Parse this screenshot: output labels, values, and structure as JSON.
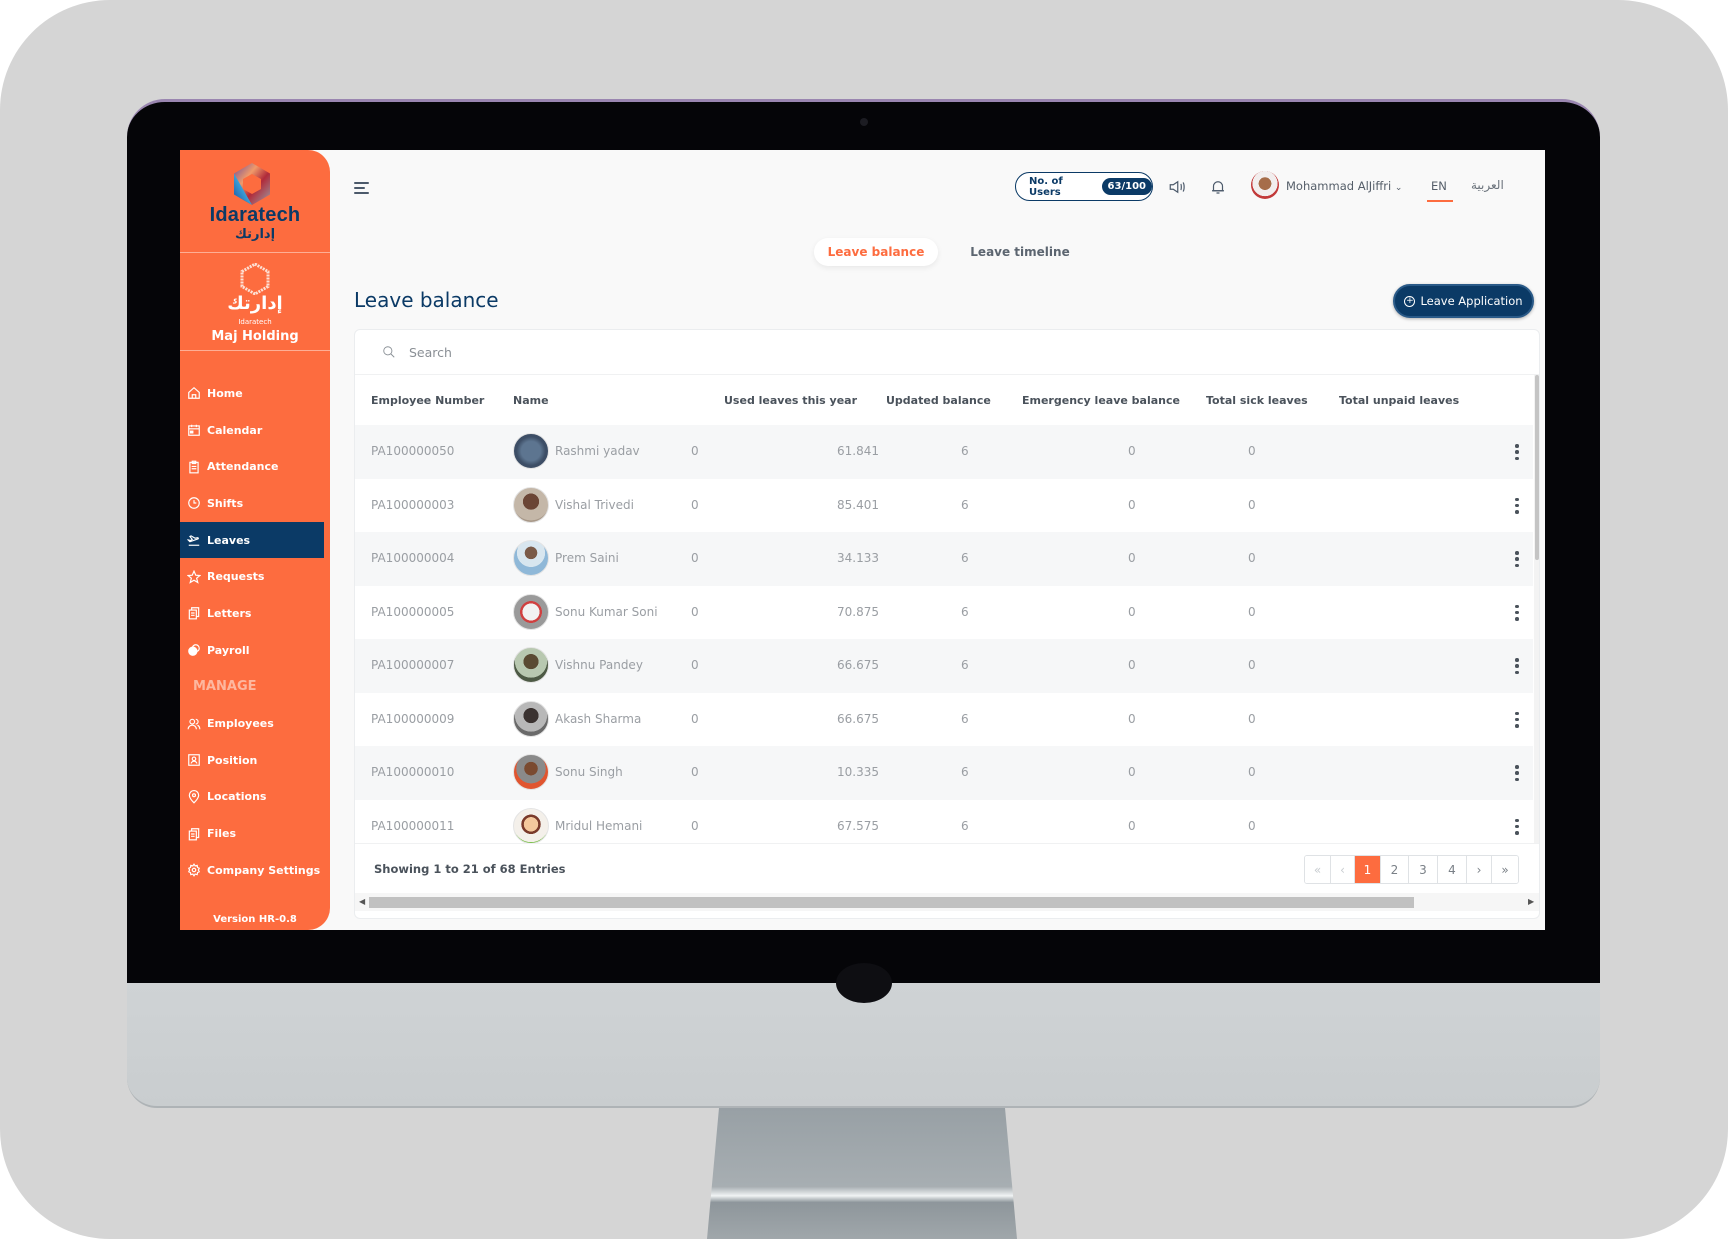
{
  "brand": {
    "logo_text": "Idaratech",
    "logo_arabic": "إدارتك",
    "company_arabic": "إدارتك",
    "company_sub": "Idaratech",
    "company_name": "Maj Holding",
    "accent_color": "#fd6c3f",
    "primary_color": "#0b3a66"
  },
  "sidebar": {
    "items": [
      {
        "label": "Home",
        "icon": "home-icon"
      },
      {
        "label": "Calendar",
        "icon": "calendar-icon"
      },
      {
        "label": "Attendance",
        "icon": "clipboard-icon"
      },
      {
        "label": "Shifts",
        "icon": "clock-icon"
      },
      {
        "label": "Leaves",
        "icon": "airplane-departure-icon",
        "active": true
      },
      {
        "label": "Requests",
        "icon": "star-icon"
      },
      {
        "label": "Letters",
        "icon": "documents-icon"
      },
      {
        "label": "Payroll",
        "icon": "coins-icon"
      }
    ],
    "section_label": "MANAGE",
    "manage_items": [
      {
        "label": "Employees",
        "icon": "users-icon"
      },
      {
        "label": "Position",
        "icon": "id-card-icon"
      },
      {
        "label": "Locations",
        "icon": "map-pin-icon"
      },
      {
        "label": "Files",
        "icon": "files-icon"
      },
      {
        "label": "Company Settings",
        "icon": "gear-icon"
      }
    ],
    "version": "Version HR-0.8"
  },
  "topbar": {
    "users_label": "No. of Users",
    "users_count": "63/100",
    "user_name": "Mohammad AlJiffri",
    "lang_en": "EN",
    "lang_ar": "العربية"
  },
  "tabs": [
    {
      "label": "Leave balance",
      "active": true
    },
    {
      "label": "Leave timeline",
      "active": false
    }
  ],
  "page": {
    "title": "Leave balance",
    "leave_application_label": "Leave Application",
    "search_placeholder": "Search"
  },
  "table": {
    "columns": [
      "Employee Number",
      "Name",
      "Used leaves this year",
      "Updated balance",
      "Emergency leave balance",
      "Total sick leaves",
      "Total unpaid leaves"
    ],
    "rows": [
      {
        "employee_number": "PA100000050",
        "name": "Rashmi yadav",
        "used": "0",
        "balance": "61.841",
        "emergency": "6",
        "sick": "0",
        "unpaid": "0"
      },
      {
        "employee_number": "PA100000003",
        "name": "Vishal Trivedi",
        "used": "0",
        "balance": "85.401",
        "emergency": "6",
        "sick": "0",
        "unpaid": "0"
      },
      {
        "employee_number": "PA100000004",
        "name": "Prem Saini",
        "used": "0",
        "balance": "34.133",
        "emergency": "6",
        "sick": "0",
        "unpaid": "0"
      },
      {
        "employee_number": "PA100000005",
        "name": "Sonu Kumar Soni",
        "used": "0",
        "balance": "70.875",
        "emergency": "6",
        "sick": "0",
        "unpaid": "0"
      },
      {
        "employee_number": "PA100000007",
        "name": "Vishnu Pandey",
        "used": "0",
        "balance": "66.675",
        "emergency": "6",
        "sick": "0",
        "unpaid": "0"
      },
      {
        "employee_number": "PA100000009",
        "name": "Akash Sharma",
        "used": "0",
        "balance": "66.675",
        "emergency": "6",
        "sick": "0",
        "unpaid": "0"
      },
      {
        "employee_number": "PA100000010",
        "name": "Sonu Singh",
        "used": "0",
        "balance": "10.335",
        "emergency": "6",
        "sick": "0",
        "unpaid": "0"
      },
      {
        "employee_number": "PA100000011",
        "name": "Mridul Hemani",
        "used": "0",
        "balance": "67.575",
        "emergency": "6",
        "sick": "0",
        "unpaid": "0"
      }
    ]
  },
  "footer": {
    "showing": "Showing 1 to 21 of 68 Entries",
    "pagination": {
      "first": "«",
      "prev": "‹",
      "pages": [
        "1",
        "2",
        "3",
        "4"
      ],
      "current": "1",
      "next": "›",
      "last": "»"
    }
  }
}
